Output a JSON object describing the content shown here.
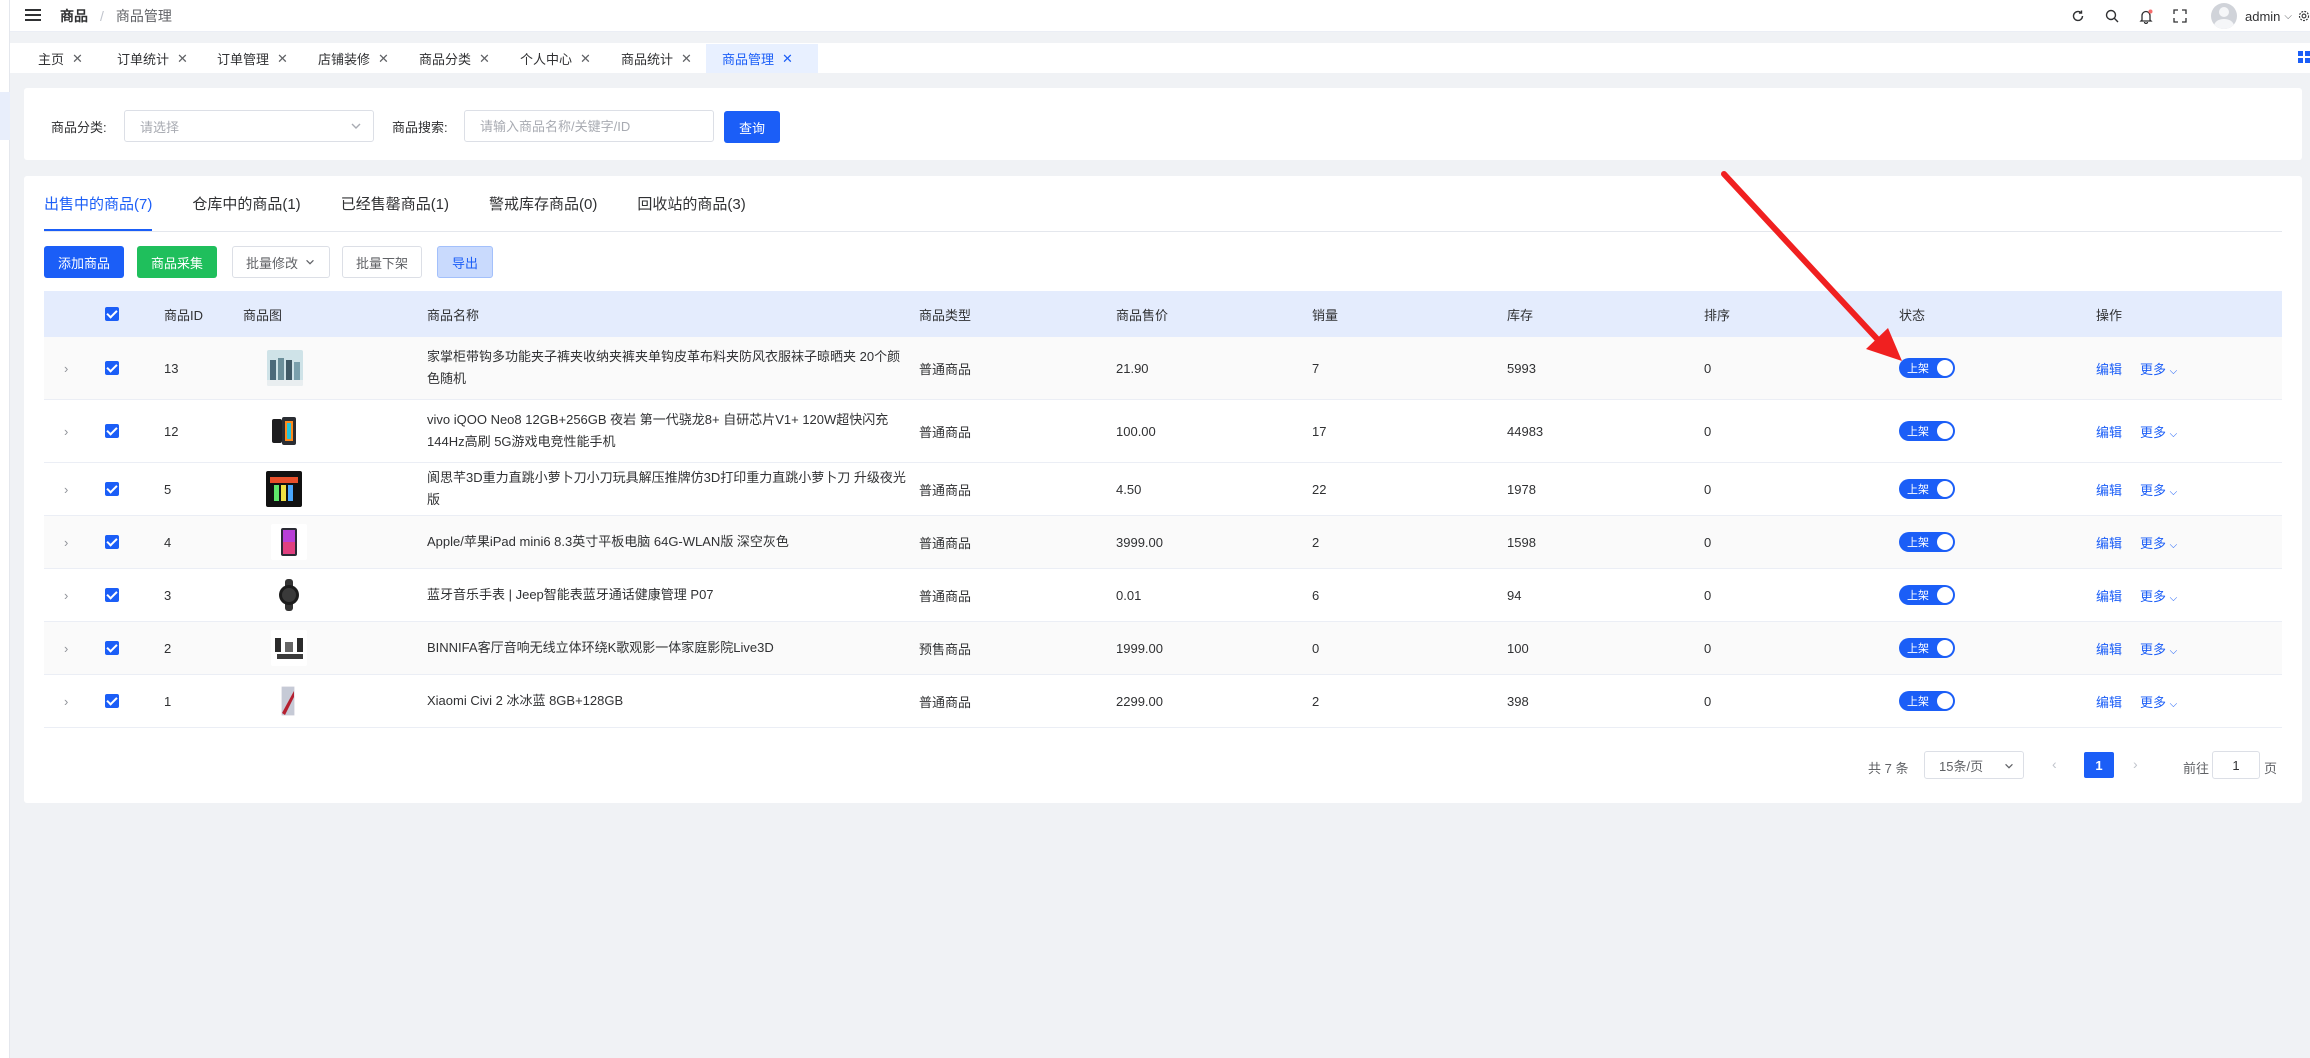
{
  "header": {
    "breadcrumb": [
      "商品",
      "商品管理"
    ],
    "user": "admin",
    "icons": [
      "refresh-icon",
      "search-icon",
      "bell-icon",
      "fullscreen-icon",
      "settings-icon"
    ]
  },
  "view_tabs": [
    {
      "label": "主页",
      "active": false
    },
    {
      "label": "订单统计",
      "active": false
    },
    {
      "label": "订单管理",
      "active": false
    },
    {
      "label": "店铺装修",
      "active": false
    },
    {
      "label": "商品分类",
      "active": false
    },
    {
      "label": "个人中心",
      "active": false
    },
    {
      "label": "商品统计",
      "active": false
    },
    {
      "label": "商品管理",
      "active": true
    }
  ],
  "filter": {
    "category_label": "商品分类:",
    "category_placeholder": "请选择",
    "search_label": "商品搜索:",
    "search_placeholder": "请输入商品名称/关键字/ID",
    "query_button": "查询"
  },
  "tabs": [
    {
      "label": "出售中的商品(7)",
      "active": true
    },
    {
      "label": "仓库中的商品(1)",
      "active": false
    },
    {
      "label": "已经售罄商品(1)",
      "active": false
    },
    {
      "label": "警戒库存商品(0)",
      "active": false
    },
    {
      "label": "回收站的商品(3)",
      "active": false
    }
  ],
  "toolbar": {
    "add": "添加商品",
    "collect": "商品采集",
    "batch_edit": "批量修改",
    "batch_off": "批量下架",
    "export": "导出"
  },
  "table": {
    "columns": {
      "id": "商品ID",
      "image": "商品图",
      "name": "商品名称",
      "type": "商品类型",
      "price": "商品售价",
      "sales": "销量",
      "stock": "库存",
      "sort": "排序",
      "status": "状态",
      "ops": "操作"
    },
    "rows": [
      {
        "id": "13",
        "name": "家掌柜带钩多功能夹子裤夹收纳夹裤夹单钩皮革布料夹防风衣服袜子晾晒夹 20个颜色随机",
        "type": "普通商品",
        "price": "21.90",
        "sales": "7",
        "stock": "5993",
        "sort": "0",
        "status": "上架",
        "edit": "编辑",
        "more": "更多"
      },
      {
        "id": "12",
        "name": "vivo iQOO Neo8 12GB+256GB 夜岩 第一代骁龙8+ 自研芯片V1+ 120W超快闪充 144Hz高刷 5G游戏电竞性能手机",
        "type": "普通商品",
        "price": "100.00",
        "sales": "17",
        "stock": "44983",
        "sort": "0",
        "status": "上架",
        "edit": "编辑",
        "more": "更多"
      },
      {
        "id": "5",
        "name": "阆思芊3D重力直跳小萝卜刀小刀玩具解压推牌仿3D打印重力直跳小萝卜刀 升级夜光版",
        "type": "普通商品",
        "price": "4.50",
        "sales": "22",
        "stock": "1978",
        "sort": "0",
        "status": "上架",
        "edit": "编辑",
        "more": "更多"
      },
      {
        "id": "4",
        "name": "Apple/苹果iPad mini6 8.3英寸平板电脑 64G-WLAN版 深空灰色",
        "type": "普通商品",
        "price": "3999.00",
        "sales": "2",
        "stock": "1598",
        "sort": "0",
        "status": "上架",
        "edit": "编辑",
        "more": "更多"
      },
      {
        "id": "3",
        "name": "蓝牙音乐手表 | Jeep智能表蓝牙通话健康管理 P07",
        "type": "普通商品",
        "price": "0.01",
        "sales": "6",
        "stock": "94",
        "sort": "0",
        "status": "上架",
        "edit": "编辑",
        "more": "更多"
      },
      {
        "id": "2",
        "name": "BINNIFA客厅音响无线立体环绕K歌观影一体家庭影院Live3D",
        "type": "预售商品",
        "price": "1999.00",
        "sales": "0",
        "stock": "100",
        "sort": "0",
        "status": "上架",
        "edit": "编辑",
        "more": "更多"
      },
      {
        "id": "1",
        "name": "Xiaomi Civi 2 冰冰蓝 8GB+128GB",
        "type": "普通商品",
        "price": "2299.00",
        "sales": "2",
        "stock": "398",
        "sort": "0",
        "status": "上架",
        "edit": "编辑",
        "more": "更多"
      }
    ]
  },
  "pagination": {
    "total": "共 7 条",
    "page_size": "15条/页",
    "current": "1",
    "goto_label": "前往",
    "goto_value": "1",
    "page_unit": "页"
  },
  "colors": {
    "primary": "#1b5ef7",
    "success": "#1fbf5c",
    "annotation_arrow": "#f02020"
  }
}
